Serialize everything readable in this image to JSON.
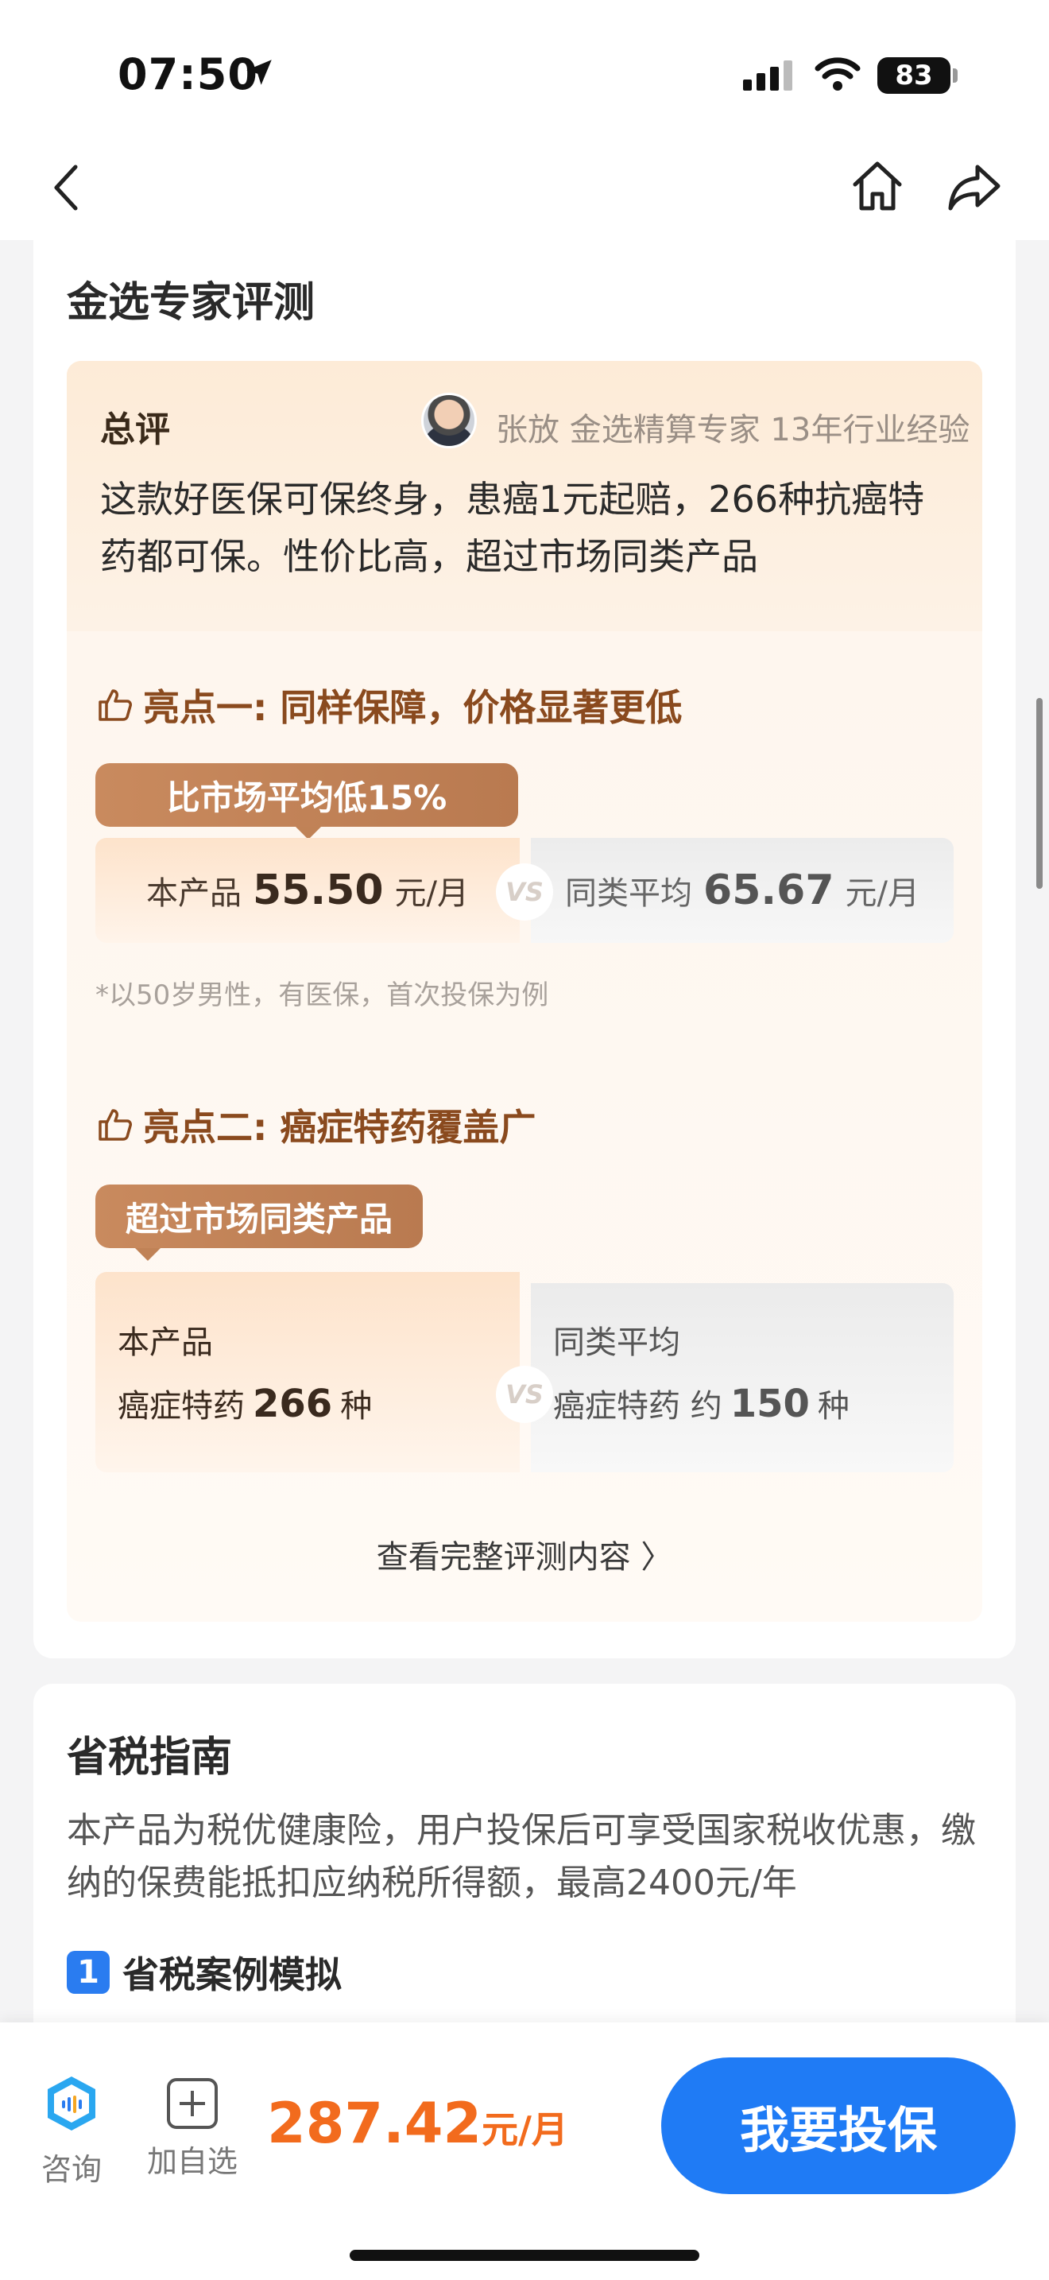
{
  "status_bar": {
    "time": "07:50",
    "battery": "83"
  },
  "expert_review": {
    "title": "金选专家评测",
    "summary_label": "总评",
    "expert_line": "张放 金选精算专家 13年行业经验",
    "summary_text": "这款好医保可保终身，患癌1元起赔，266种抗癌特药都可保。性价比高，超过市场同类产品",
    "highlight1": {
      "title": "亮点一: 同样保障，价格显著更低",
      "tag": "比市场平均低15%",
      "left_label": "本产品",
      "left_value": "55.50",
      "left_unit": "元/月",
      "right_label": "同类平均",
      "right_value": "65.67",
      "right_unit": "元/月",
      "vs": "VS",
      "footnote": "*以50岁男性，有医保，首次投保为例"
    },
    "highlight2": {
      "title": "亮点二: 癌症特药覆盖广",
      "tag": "超过市场同类产品",
      "left_label": "本产品",
      "left_prefix": "癌症特药",
      "left_value": "266",
      "left_unit": "种",
      "right_label": "同类平均",
      "right_prefix": "癌症特药 约",
      "right_value": "150",
      "right_unit": "种",
      "vs": "VS"
    },
    "view_full": "查看完整评测内容 〉"
  },
  "tax_guide": {
    "title": "省税指南",
    "description": "本产品为税优健康险，用户投保后可享受国家税收优惠，缴纳的保费能抵扣应纳税所得额，最高2400元/年",
    "case_number": "1",
    "case_title": "省税案例模拟"
  },
  "bottom_bar": {
    "consult_label": "咨询",
    "add_label": "加自选",
    "price_value": "287.42",
    "price_unit": "元/月",
    "buy_label": "我要投保"
  },
  "colors": {
    "accent_blue": "#1f7bf5",
    "price_orange": "#f26b1d",
    "highlight_brown": "#8a4a1e",
    "tag_brown": "#c08256"
  }
}
